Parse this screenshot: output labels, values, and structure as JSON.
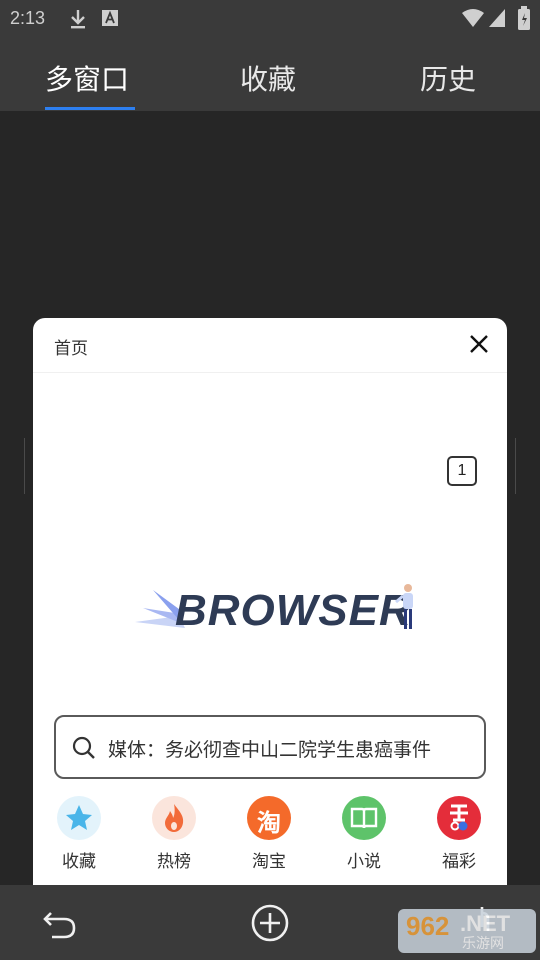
{
  "status_bar": {
    "time": "2:13",
    "icons": [
      "download-icon",
      "a-icon",
      "wifi-icon",
      "signal-icon",
      "battery-icon"
    ]
  },
  "tabs": [
    {
      "label": "多窗口",
      "active": true
    },
    {
      "label": "收藏",
      "active": false
    },
    {
      "label": "历史",
      "active": false
    }
  ],
  "window_card": {
    "title": "首页",
    "tab_count": "1",
    "logo_text": "BROWSER",
    "search_text": "媒体：务必彻查中山二院学生患癌事件"
  },
  "shortcuts": [
    {
      "label": "收藏",
      "icon": "star-icon",
      "color": "#e3f3fb"
    },
    {
      "label": "热榜",
      "icon": "flame-icon",
      "color": "#fbe5dc"
    },
    {
      "label": "淘宝",
      "icon": "taobao-icon",
      "glyph": "淘",
      "color": "#f46a2a"
    },
    {
      "label": "小说",
      "icon": "book-icon",
      "color": "#5ec36a"
    },
    {
      "label": "福彩",
      "icon": "lottery-icon",
      "color": "#e42d3a"
    }
  ],
  "watermark": {
    "num": "962",
    "net": ".NET",
    "cn": "乐游网"
  },
  "colors": {
    "accent": "#2d7ff0",
    "chrome": "#3a3a3a",
    "background": "#262626"
  }
}
